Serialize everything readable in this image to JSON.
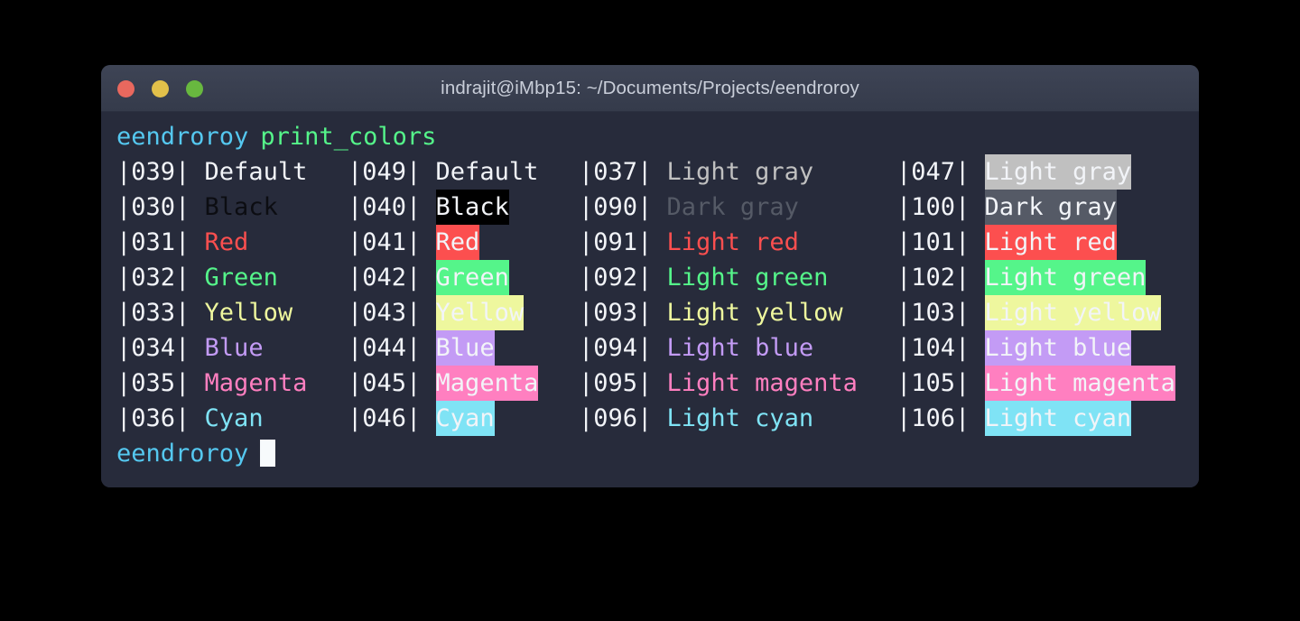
{
  "window": {
    "title": "indrajit@iMbp15: ~/Documents/Projects/eendroroy",
    "traffic_lights": [
      {
        "name": "close",
        "color": "#e9685e"
      },
      {
        "name": "minimize",
        "color": "#e2c04a"
      },
      {
        "name": "zoom",
        "color": "#68b83f"
      }
    ]
  },
  "terminal": {
    "prompt_top": {
      "user": "eendroroy",
      "command": "print_colors"
    },
    "prompt_bottom": {
      "user": "eendroroy",
      "cursor": "█"
    },
    "separator": "|",
    "columns": [
      {
        "name": "foreground-normal",
        "rows": [
          {
            "code": "039",
            "label": "Default",
            "fg": "#f2f4f8",
            "bg": "none"
          },
          {
            "code": "030",
            "label": "Black",
            "fg": "#0c0d12",
            "bg": "none"
          },
          {
            "code": "031",
            "label": "Red",
            "fg": "#fc4f4f",
            "bg": "none"
          },
          {
            "code": "032",
            "label": "Green",
            "fg": "#55f58a",
            "bg": "none"
          },
          {
            "code": "033",
            "label": "Yellow",
            "fg": "#eef79e",
            "bg": "none"
          },
          {
            "code": "034",
            "label": "Blue",
            "fg": "#c39bf5",
            "bg": "none"
          },
          {
            "code": "035",
            "label": "Magenta",
            "fg": "#ff7fc0",
            "bg": "none"
          },
          {
            "code": "036",
            "label": "Cyan",
            "fg": "#7fe3f5",
            "bg": "none"
          }
        ]
      },
      {
        "name": "background-normal",
        "rows": [
          {
            "code": "049",
            "label": "Default",
            "fg": "#f2f4f8",
            "bg": "none"
          },
          {
            "code": "040",
            "label": "Black",
            "fg": "#f2f4f8",
            "bg": "#000000"
          },
          {
            "code": "041",
            "label": "Red",
            "fg": "#f2f4f8",
            "bg": "#fc4f4f"
          },
          {
            "code": "042",
            "label": "Green",
            "fg": "#f2f4f8",
            "bg": "#55f58a"
          },
          {
            "code": "043",
            "label": "Yellow",
            "fg": "#f2f4f8",
            "bg": "#eef79e"
          },
          {
            "code": "044",
            "label": "Blue",
            "fg": "#f2f4f8",
            "bg": "#c39bf5"
          },
          {
            "code": "045",
            "label": "Magenta",
            "fg": "#f2f4f8",
            "bg": "#ff7fc0"
          },
          {
            "code": "046",
            "label": "Cyan",
            "fg": "#f2f4f8",
            "bg": "#7fe3f5"
          }
        ]
      },
      {
        "name": "foreground-bright",
        "rows": [
          {
            "code": "037",
            "label": "Light gray",
            "fg": "#c0c0c0",
            "bg": "none"
          },
          {
            "code": "090",
            "label": "Dark gray",
            "fg": "#555a66",
            "bg": "none"
          },
          {
            "code": "091",
            "label": "Light red",
            "fg": "#fc4f4f",
            "bg": "none"
          },
          {
            "code": "092",
            "label": "Light green",
            "fg": "#55f58a",
            "bg": "none"
          },
          {
            "code": "093",
            "label": "Light yellow",
            "fg": "#eef79e",
            "bg": "none"
          },
          {
            "code": "094",
            "label": "Light blue",
            "fg": "#c39bf5",
            "bg": "none"
          },
          {
            "code": "095",
            "label": "Light magenta",
            "fg": "#ff7fc0",
            "bg": "none"
          },
          {
            "code": "096",
            "label": "Light cyan",
            "fg": "#7fe3f5",
            "bg": "none"
          }
        ]
      },
      {
        "name": "background-bright",
        "rows": [
          {
            "code": "047",
            "label": "Light gray",
            "fg": "#f2f4f8",
            "bg": "#c0c0c0"
          },
          {
            "code": "100",
            "label": "Dark gray",
            "fg": "#f2f4f8",
            "bg": "#555a66"
          },
          {
            "code": "101",
            "label": "Light red",
            "fg": "#f2f4f8",
            "bg": "#fc4f4f"
          },
          {
            "code": "102",
            "label": "Light green",
            "fg": "#f2f4f8",
            "bg": "#55f58a"
          },
          {
            "code": "103",
            "label": "Light yellow",
            "fg": "#f2f4f8",
            "bg": "#eef79e"
          },
          {
            "code": "104",
            "label": "Light blue",
            "fg": "#f2f4f8",
            "bg": "#c39bf5"
          },
          {
            "code": "105",
            "label": "Light magenta",
            "fg": "#f2f4f8",
            "bg": "#ff7fc0"
          },
          {
            "code": "106",
            "label": "Light cyan",
            "fg": "#f2f4f8",
            "bg": "#7fe3f5"
          }
        ]
      }
    ]
  }
}
